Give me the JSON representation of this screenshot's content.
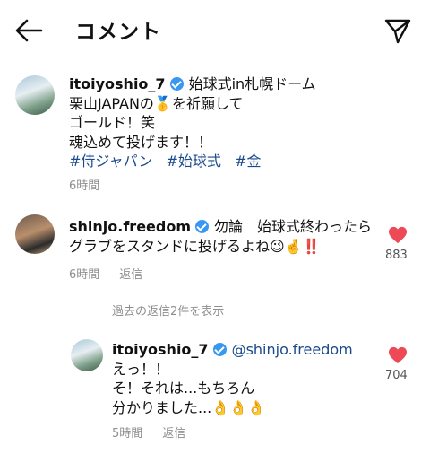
{
  "header": {
    "title": "コメント"
  },
  "caption": {
    "username": "itoiyoshio_7",
    "lines": [
      "始球式in札幌ドーム",
      "栗山JAPANの🥇を祈願して",
      "ゴールド！笑",
      "魂込めて投げます！！"
    ],
    "tags": [
      "#侍ジャパン",
      "#始球式",
      "#金"
    ],
    "time": "6時間"
  },
  "comment": {
    "username": "shinjo.freedom",
    "lines": [
      "勿論　始球式終わったら",
      "グラブをスタンドに投げるよね😉🤞‼️"
    ],
    "time": "6時間",
    "reply_label": "返信",
    "likes": "883"
  },
  "view_replies": "過去の返信2件を表示",
  "reply": {
    "username": "itoiyoshio_7",
    "mention": "@shinjo.freedom",
    "lines": [
      "えっ！！",
      "そ！それは...もちろん",
      "分かりました...👌👌👌"
    ],
    "time": "5時間",
    "reply_label": "返信",
    "likes": "704"
  },
  "colors": {
    "heart": "#ed4956",
    "verified": "#3897f0",
    "link": "#1a4a8c"
  }
}
